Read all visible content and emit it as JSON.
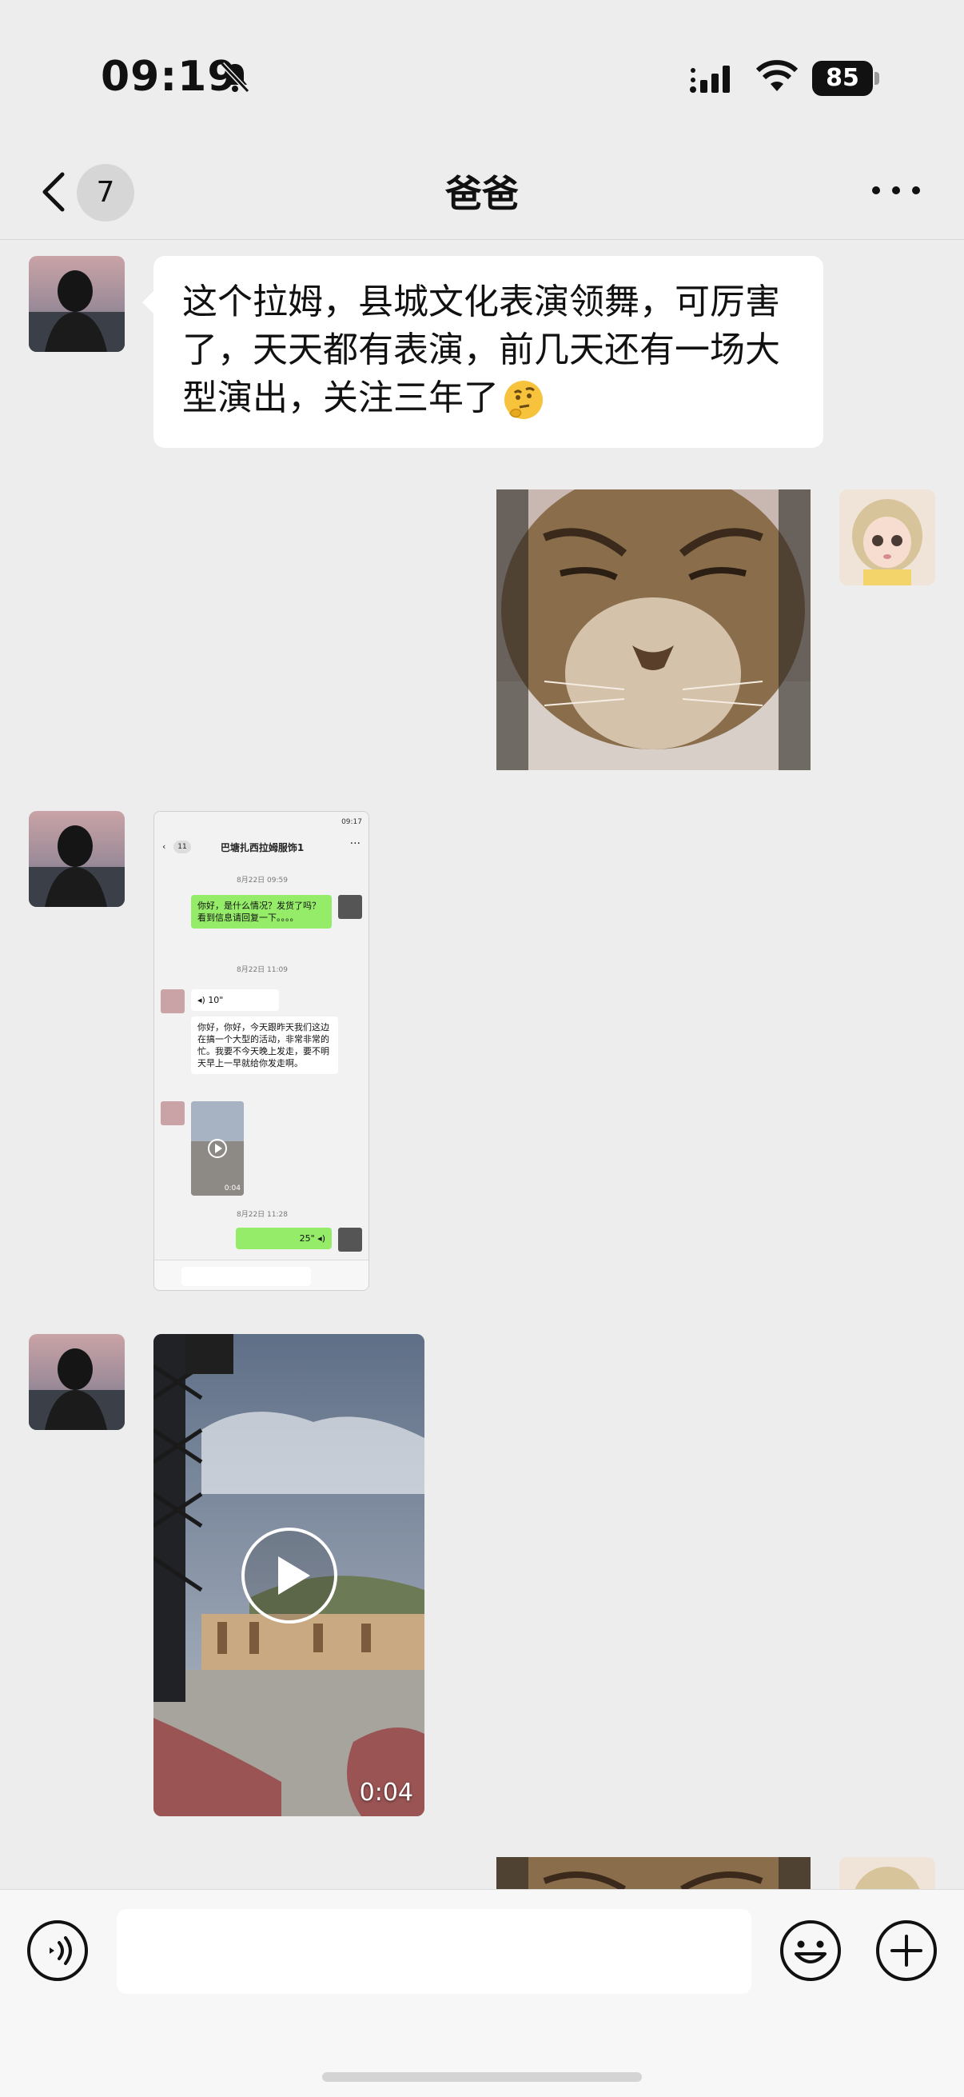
{
  "status_bar": {
    "time": "09:19",
    "battery": "85"
  },
  "nav": {
    "back_count": "7",
    "title": "爸爸"
  },
  "messages": {
    "text_1": "这个拉姆，县城文化表演领舞，可厉害了，天天都有表演，前几天还有一场大型演出，关注三年了",
    "text_1_emoji": "thinking-face-icon",
    "video_duration": "0:04"
  },
  "forwarded_screenshot": {
    "status_time": "09:17",
    "back_count": "11",
    "title": "巴塘扎西拉姆服饰1",
    "time_1": "8月22日 09:59",
    "msg_1": "你好，是什么情况？发货了吗？看到信息请回复一下。。。。",
    "time_2": "8月22日 11:09",
    "voice_1": "10\"",
    "msg_2": "你好，你好，今天跟昨天我们这边在搞一个大型的活动，非常非常的忙。我要不今天晚上发走，要不明天早上一早就给你发走啊。",
    "video_duration": "0:04",
    "time_3": "8月22日 11:28",
    "voice_2": "25\""
  },
  "colors": {
    "background": "#ededed",
    "bubble_self": "#95ec69",
    "bubble_other": "#ffffff"
  }
}
